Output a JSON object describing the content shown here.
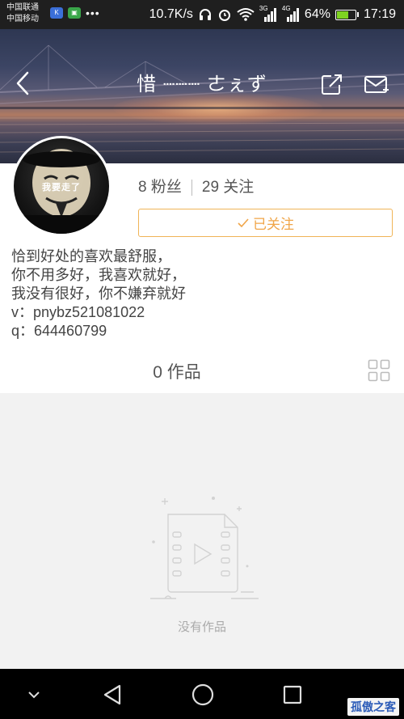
{
  "status_bar": {
    "carrier_1": "中国联通",
    "carrier_2": "中国移动",
    "speed": "10.7K/s",
    "network_1": "3G",
    "network_2": "4G",
    "battery": "64%",
    "battery_level": 0.64,
    "time": "17:19"
  },
  "header": {
    "title": "惜 ┈┈┈ ㄜぇず"
  },
  "profile": {
    "avatar_text": "我要走了",
    "fans_count": "8",
    "fans_label": "粉丝",
    "follow_count": "29",
    "follow_label": "关注",
    "followed_label": "已关注",
    "bio_lines": [
      "恰到好处的喜欢最舒服，",
      "你不用多好，我喜欢就好，",
      "我没有很好，你不嫌弃就好",
      "v：pnybz521081022",
      "q：644460799"
    ]
  },
  "works": {
    "count": "0",
    "label": "作品"
  },
  "empty_state": {
    "text": "没有作品"
  },
  "watermark": "孤傲之客",
  "colors": {
    "accent": "#f0a548",
    "status_bar_bg": "#1f1f1f",
    "navbar_bg": "#000000",
    "battery_fill": "#7ed321"
  }
}
